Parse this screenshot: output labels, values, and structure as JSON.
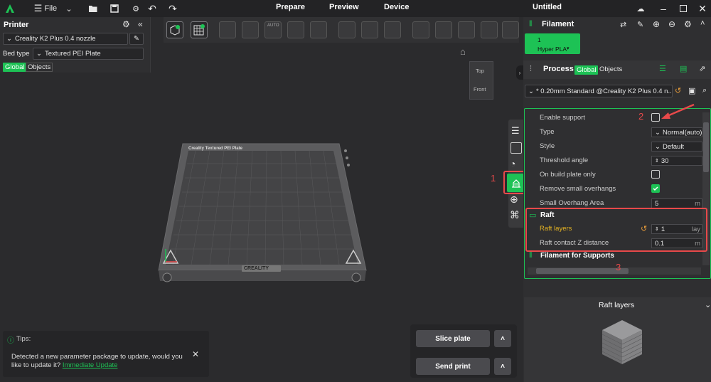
{
  "titlebar": {
    "file_label": "File",
    "tabs": [
      "Prepare",
      "Preview",
      "Device"
    ],
    "doc_title": "Untitled"
  },
  "printer_panel": {
    "title": "Printer",
    "printer_name": "Creality K2 Plus 0.4 nozzle",
    "bed_type_label": "Bed type",
    "bed_type_value": "Textured PEI Plate",
    "tab_global": "Global",
    "tab_objects": "Objects"
  },
  "viewport": {
    "view_top": "Top",
    "view_front": "Front",
    "plate_title": "Creality Textured PEI Plate",
    "plate_brand": "CREALITY",
    "annot_1": "1"
  },
  "filament_panel": {
    "title": "Filament",
    "slot_number": "1",
    "slot_name": "Hyper PLA"
  },
  "process_panel": {
    "title": "Process",
    "tab_global": "Global",
    "tab_objects": "Objects",
    "profile": "* 0.20mm Standard @Creality K2 Plus 0.4 n...",
    "rows": [
      {
        "label": "Enable support",
        "kind": "checkbox",
        "checked": false
      },
      {
        "label": "Type",
        "value": "Normal(auto)"
      },
      {
        "label": "Style",
        "value": "Default"
      },
      {
        "label": "Threshold angle",
        "value": "30"
      },
      {
        "label": "On build plate only",
        "kind": "checkbox",
        "checked": false
      },
      {
        "label": "Remove small overhangs",
        "kind": "checkbox",
        "checked": true
      },
      {
        "label": "Small Overhang Area",
        "value": "5",
        "unit": "m"
      }
    ],
    "raft_section": "Raft",
    "raft_layers_label": "Raft layers",
    "raft_layers_value": "1",
    "raft_layers_unit": "lay",
    "raft_z_label": "Raft contact Z distance",
    "raft_z_value": "0.1",
    "raft_z_unit": "m",
    "filament_support_section": "Filament for Supports",
    "annot_2": "2",
    "annot_3": "3"
  },
  "help_panel": {
    "title": "Raft layers"
  },
  "tips": {
    "title": "Tips:",
    "message": "Detected a new parameter package to update, would you like to update it?",
    "link": "Immediate Update"
  },
  "actions": {
    "slice": "Slice plate",
    "send": "Send print"
  },
  "colors": {
    "accent": "#1dc255",
    "annotation": "#e8494a",
    "highlight_label": "#e6b422"
  }
}
